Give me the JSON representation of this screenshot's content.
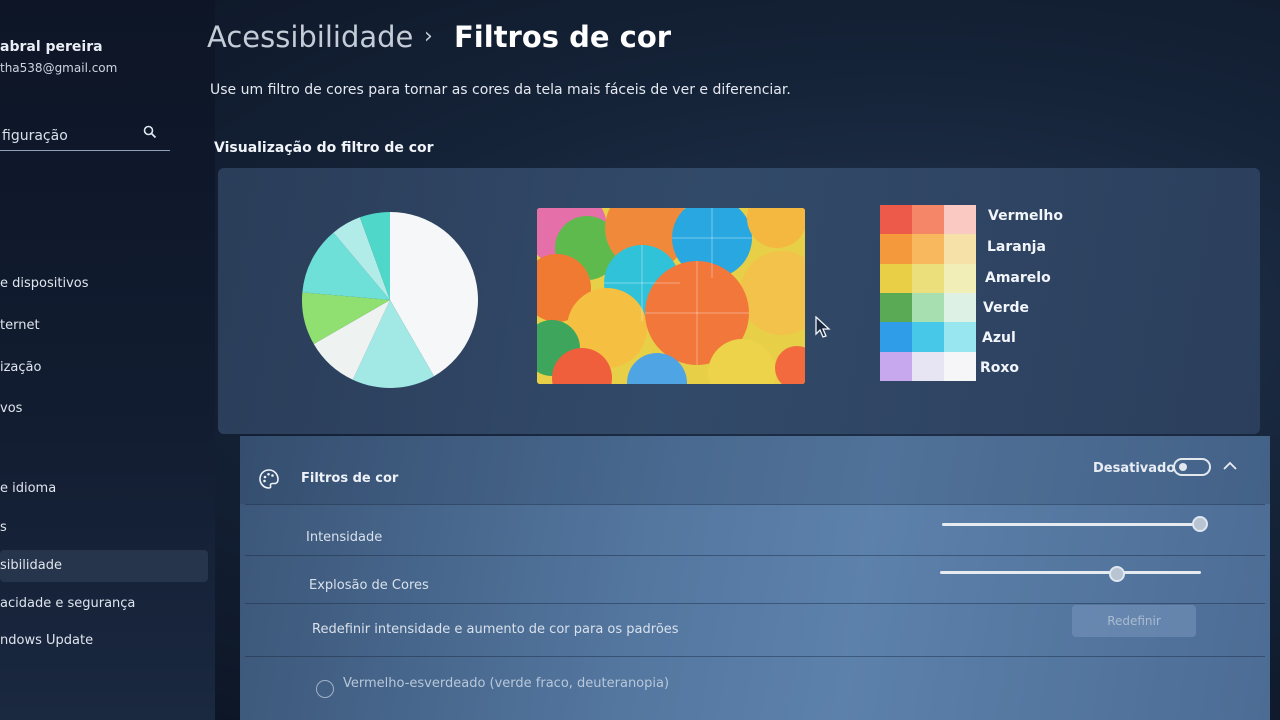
{
  "sidebar": {
    "user_name": "abral pereira",
    "user_email": "tha538@gmail.com",
    "search_placeholder": "figuração",
    "items": [
      {
        "label": "e dispositivos"
      },
      {
        "label": "ternet"
      },
      {
        "label": "ização"
      },
      {
        "label": "vos"
      },
      {
        "label": "e idioma"
      },
      {
        "label": "s"
      },
      {
        "label": "sibilidade",
        "selected": true
      },
      {
        "label": "acidade e segurança"
      },
      {
        "label": "ndows Update"
      }
    ]
  },
  "header": {
    "parent": "Acessibilidade",
    "separator": "›",
    "current": "Filtros de cor"
  },
  "description": "Use um filtro de cores para tornar as cores da tela mais fáceis de ver e diferenciar.",
  "preview": {
    "title": "Visualização do filtro de cor",
    "swatch_labels": [
      "Vermelho",
      "Laranja",
      "Amarelo",
      "Verde",
      "Azul",
      "Roxo"
    ],
    "swatch_colors": [
      [
        "#ee5a4a",
        "#f58768",
        "#f9c9c2"
      ],
      [
        "#f59a3c",
        "#f8b85e",
        "#f6e2a8"
      ],
      [
        "#e8cf46",
        "#eadf7a",
        "#f1eeb8"
      ],
      [
        "#5aaa55",
        "#a8dfb0",
        "#ddf2e4"
      ],
      [
        "#2f9de8",
        "#48c8e8",
        "#98e6ef"
      ],
      [
        "#c7a8ef",
        "#e7e4f4",
        "#f6f6f8"
      ]
    ],
    "pie_colors": [
      "#f5f7f9",
      "#a2e8e4",
      "#eef3f2",
      "#8fe070",
      "#6ee0d8",
      "#b2ece8",
      "#4fd8c9"
    ]
  },
  "filters": {
    "label": "Filtros de cor",
    "status": "Desativado",
    "toggle_on": false,
    "intensity_label": "Intensidade",
    "intensity_value": 1.0,
    "boost_label": "Explosão de Cores",
    "boost_value": 0.68,
    "reset_label": "Redefinir intensidade e aumento de cor para os padrões",
    "reset_button": "Redefinir",
    "option_1": "Vermelho-esverdeado (verde fraco, deuteranopia)"
  }
}
